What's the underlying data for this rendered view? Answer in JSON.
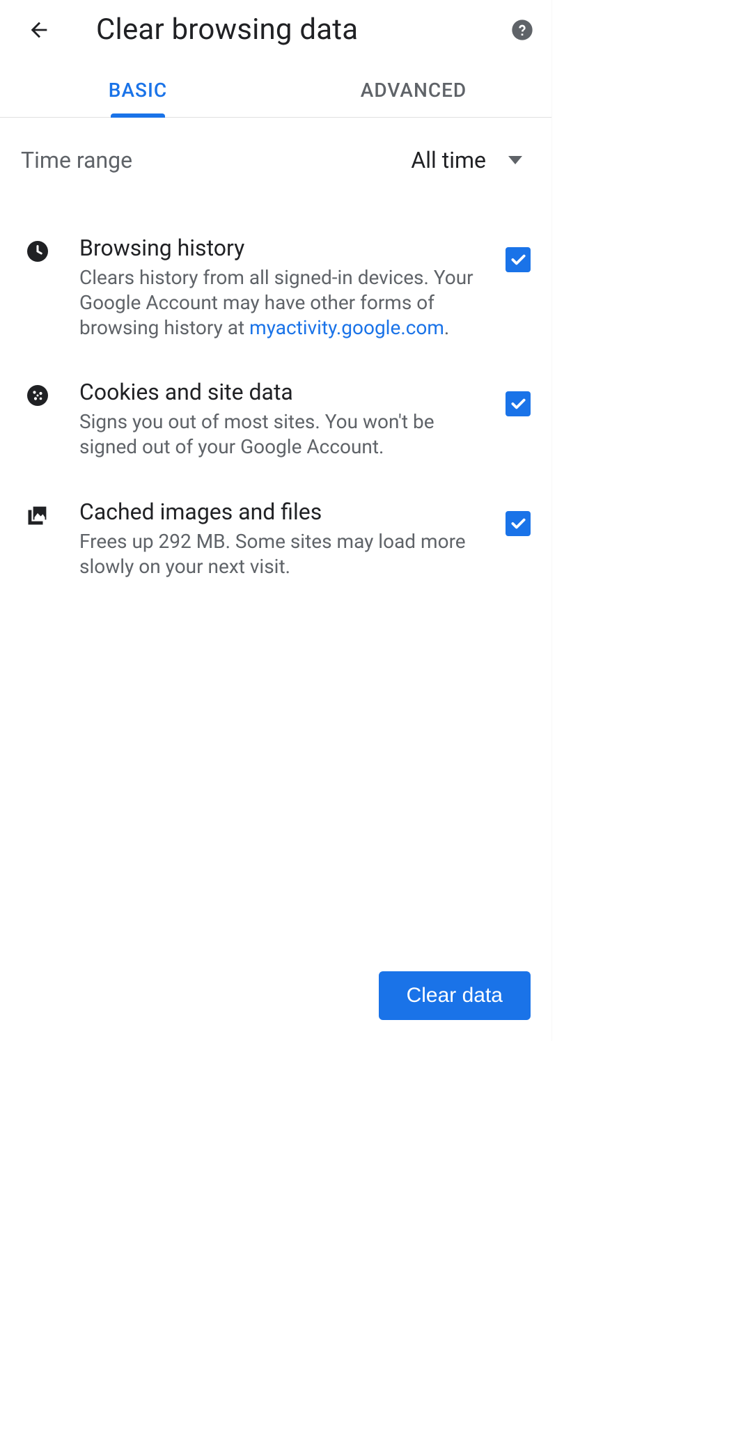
{
  "header": {
    "title": "Clear browsing data"
  },
  "tabs": {
    "basic": "BASIC",
    "advanced": "ADVANCED"
  },
  "timeRange": {
    "label": "Time range",
    "value": "All time"
  },
  "options": {
    "browsingHistory": {
      "title": "Browsing history",
      "descPrefix": "Clears history from all signed-in devices. Your Google Account may have other forms of browsing history at ",
      "link": "myactivity.google.com",
      "descSuffix": ".",
      "checked": true
    },
    "cookies": {
      "title": "Cookies and site data",
      "desc": "Signs you out of most sites. You won't be signed out of your Google Account.",
      "checked": true
    },
    "cache": {
      "title": "Cached images and files",
      "desc": "Frees up 292 MB. Some sites may load more slowly on your next visit.",
      "checked": true
    }
  },
  "clearButton": "Clear data"
}
